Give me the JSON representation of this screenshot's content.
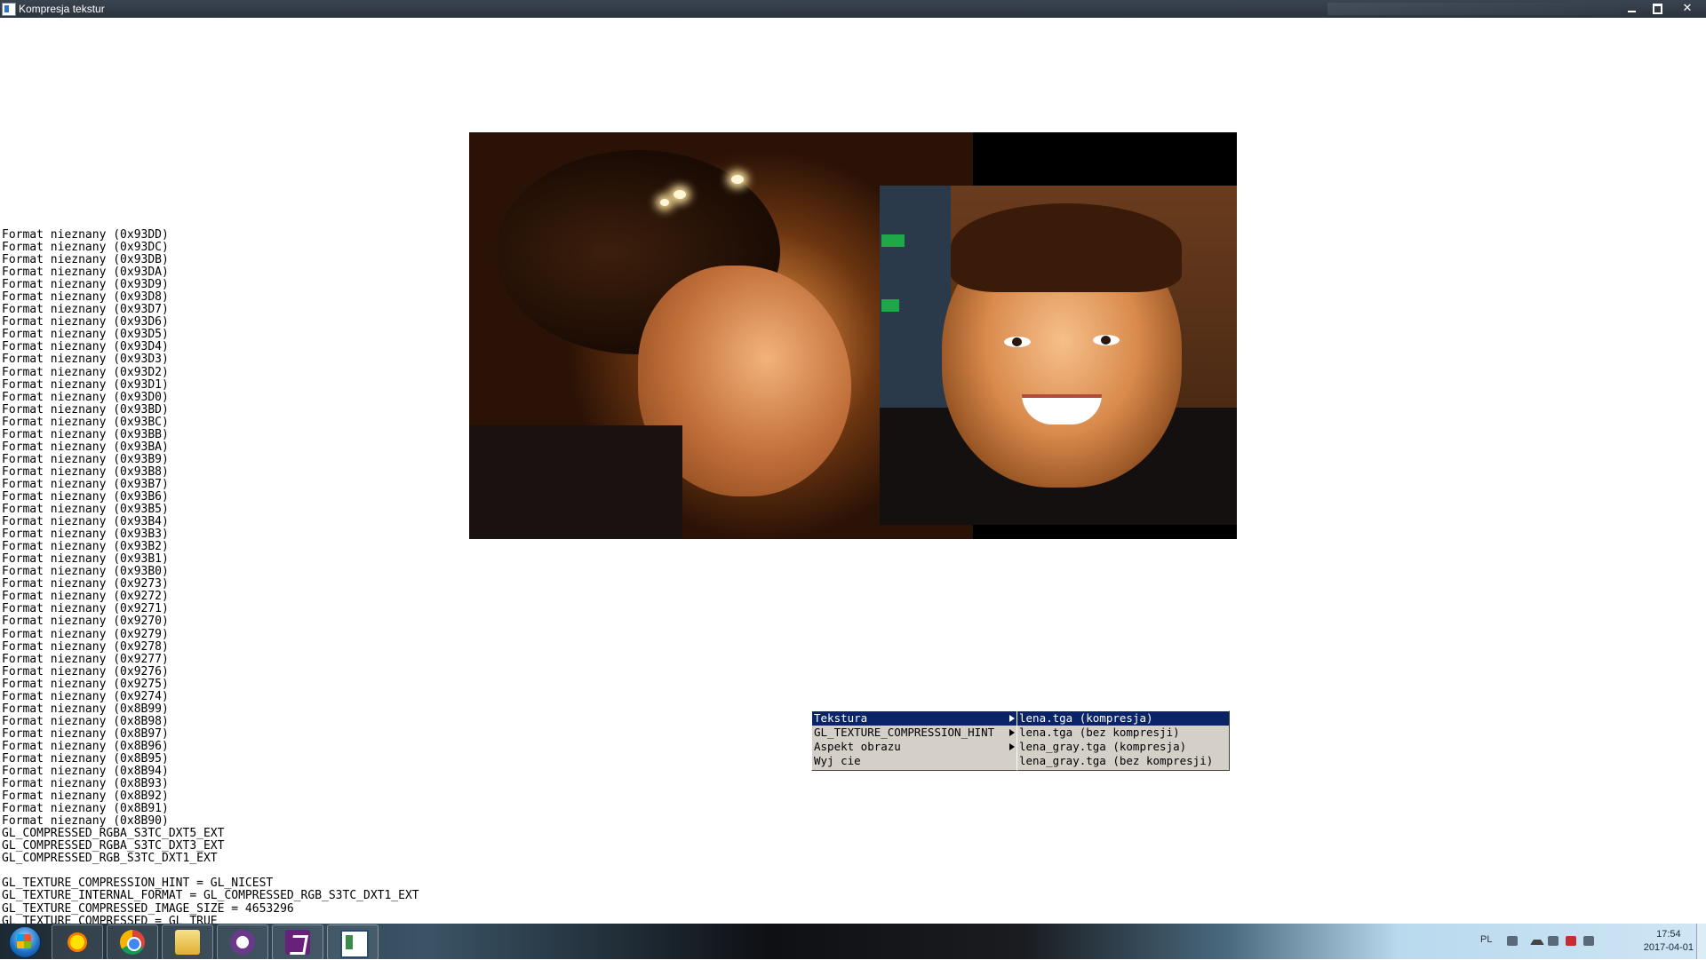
{
  "window": {
    "title": "Kompresja tekstur"
  },
  "log_lines": [
    "Format nieznany (0x93DD)",
    "Format nieznany (0x93DC)",
    "Format nieznany (0x93DB)",
    "Format nieznany (0x93DA)",
    "Format nieznany (0x93D9)",
    "Format nieznany (0x93D8)",
    "Format nieznany (0x93D7)",
    "Format nieznany (0x93D6)",
    "Format nieznany (0x93D5)",
    "Format nieznany (0x93D4)",
    "Format nieznany (0x93D3)",
    "Format nieznany (0x93D2)",
    "Format nieznany (0x93D1)",
    "Format nieznany (0x93D0)",
    "Format nieznany (0x93BD)",
    "Format nieznany (0x93BC)",
    "Format nieznany (0x93BB)",
    "Format nieznany (0x93BA)",
    "Format nieznany (0x93B9)",
    "Format nieznany (0x93B8)",
    "Format nieznany (0x93B7)",
    "Format nieznany (0x93B6)",
    "Format nieznany (0x93B5)",
    "Format nieznany (0x93B4)",
    "Format nieznany (0x93B3)",
    "Format nieznany (0x93B2)",
    "Format nieznany (0x93B1)",
    "Format nieznany (0x93B0)",
    "Format nieznany (0x9273)",
    "Format nieznany (0x9272)",
    "Format nieznany (0x9271)",
    "Format nieznany (0x9270)",
    "Format nieznany (0x9279)",
    "Format nieznany (0x9278)",
    "Format nieznany (0x9277)",
    "Format nieznany (0x9276)",
    "Format nieznany (0x9275)",
    "Format nieznany (0x9274)",
    "Format nieznany (0x8B99)",
    "Format nieznany (0x8B98)",
    "Format nieznany (0x8B97)",
    "Format nieznany (0x8B96)",
    "Format nieznany (0x8B95)",
    "Format nieznany (0x8B94)",
    "Format nieznany (0x8B93)",
    "Format nieznany (0x8B92)",
    "Format nieznany (0x8B91)",
    "Format nieznany (0x8B90)",
    "GL_COMPRESSED_RGBA_S3TC_DXT5_EXT",
    "GL_COMPRESSED_RGBA_S3TC_DXT3_EXT",
    "GL_COMPRESSED_RGB_S3TC_DXT1_EXT",
    "",
    "GL_TEXTURE_COMPRESSION_HINT = GL_NICEST",
    "GL_TEXTURE_INTERNAL_FORMAT = GL_COMPRESSED_RGB_S3TC_DXT1_EXT",
    "GL_TEXTURE_COMPRESSED_IMAGE_SIZE = 4653296",
    "GL_TEXTURE_COMPRESSED = GL_TRUE"
  ],
  "context_menu": {
    "items": [
      {
        "label": "Tekstura",
        "submenu": true,
        "selected": true
      },
      {
        "label": "GL_TEXTURE_COMPRESSION_HINT",
        "submenu": true,
        "selected": false
      },
      {
        "label": "Aspekt obrazu",
        "submenu": true,
        "selected": false
      },
      {
        "label": "Wyj cie",
        "submenu": false,
        "selected": false
      }
    ],
    "submenu_items": [
      {
        "label": "lena.tga (kompresja)",
        "selected": true
      },
      {
        "label": "lena.tga (bez kompresji)",
        "selected": false
      },
      {
        "label": "lena_gray.tga (kompresja)",
        "selected": false
      },
      {
        "label": "lena_gray.tga (bez kompresji)",
        "selected": false
      }
    ]
  },
  "taskbar": {
    "apps": [
      "start-orb",
      "sun-icon",
      "chrome-icon",
      "folder-icon",
      "cat-icon",
      "visual-studio-icon",
      "window-app-icon"
    ],
    "language": "PL",
    "time": "17:54",
    "date": "2017-04-01"
  },
  "colors": {
    "menu_bg": "#d4d0c8",
    "menu_selected": "#0a246a",
    "titlebar": "#2b333d"
  }
}
